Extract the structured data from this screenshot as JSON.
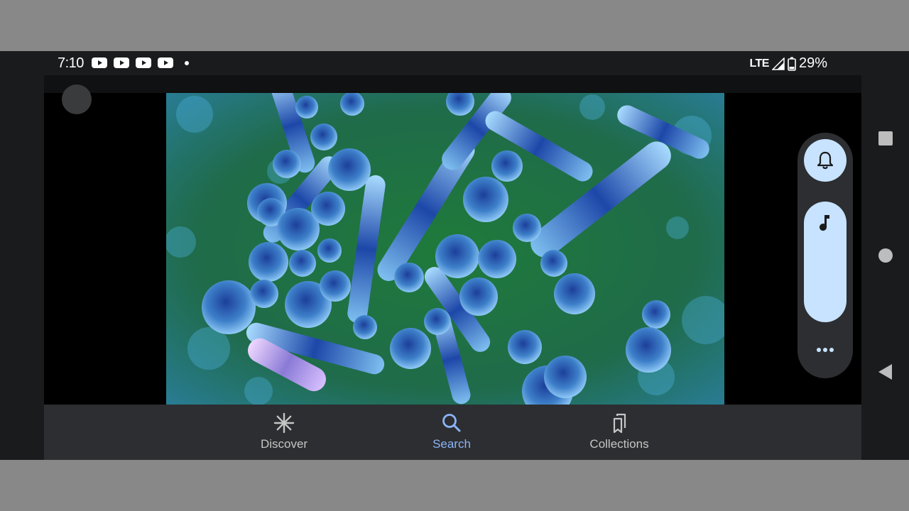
{
  "status_bar": {
    "time": "7:10",
    "notifications": [
      "youtube-icon",
      "youtube-icon",
      "youtube-icon",
      "youtube-icon"
    ],
    "network": "LTE",
    "battery": "29%"
  },
  "bottom_nav": {
    "items": [
      {
        "label": "Discover",
        "icon": "asterisk-icon",
        "active": false
      },
      {
        "label": "Search",
        "icon": "search-icon",
        "active": true
      },
      {
        "label": "Collections",
        "icon": "bookmarks-icon",
        "active": false
      }
    ]
  },
  "volume_panel": {
    "ringer_icon": "bell-icon",
    "stream_icon": "music-note-icon",
    "more_icon": "more-horizontal-icon",
    "level": 1.0
  },
  "system_nav": [
    "recents-square-icon",
    "home-circle-icon",
    "back-triangle-icon"
  ],
  "colors": {
    "accent": "#8ab4f8",
    "panel": "#2d2e31",
    "volume_fill": "#c7e3ff"
  }
}
